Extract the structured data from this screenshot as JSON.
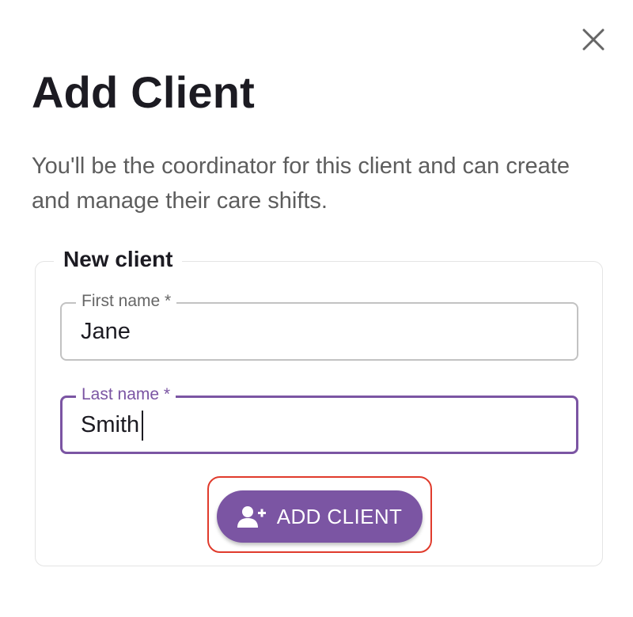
{
  "dialog": {
    "title": "Add Client",
    "description": "You'll be the coordinator for this client and can create and manage their care shifts.",
    "close_icon": "close-icon"
  },
  "form": {
    "legend": "New client",
    "first_name": {
      "label": "First name *",
      "value": "Jane"
    },
    "last_name": {
      "label": "Last name *",
      "value": "Smith",
      "focused": true
    },
    "submit": {
      "label": "ADD CLIENT",
      "icon": "add-person-icon"
    }
  },
  "colors": {
    "accent": "#7b55a3",
    "title_text": "#1c1b22",
    "body_text": "#5d5d5d",
    "highlight_outline": "#e03b2c"
  }
}
